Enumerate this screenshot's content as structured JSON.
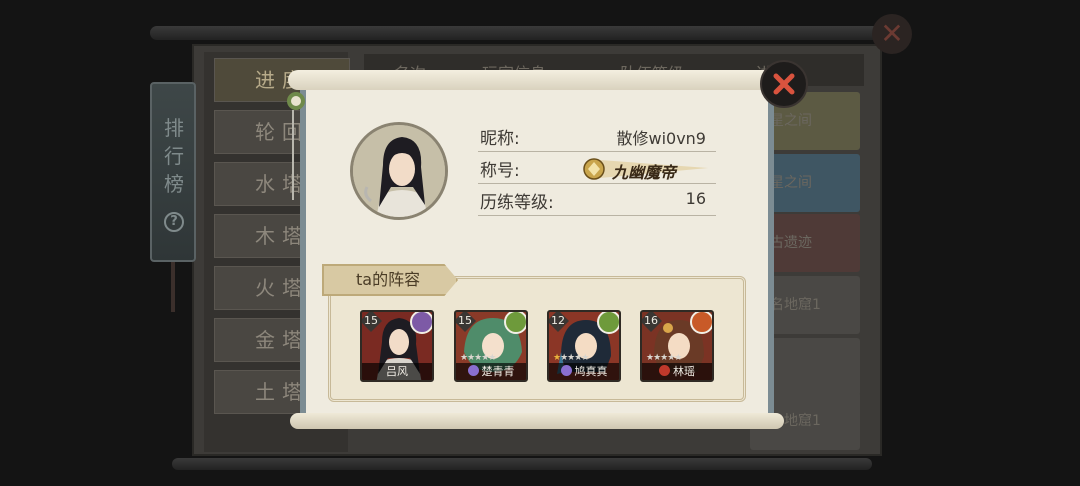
{
  "background": {
    "side_banner": {
      "title": "排行榜",
      "help_icon": "question-icon"
    },
    "tabs": [
      "进度榜",
      "轮回",
      "水塔",
      "木塔榜",
      "火塔榜",
      "金塔榜",
      "土塔榜"
    ],
    "active_tab": 0,
    "table_headers": [
      "名次",
      "玩家信息",
      "队伍等级",
      "进"
    ],
    "rows": [
      "星之间",
      "星之间",
      "古遗迹",
      "名地窟1",
      "",
      "名地窟1"
    ],
    "row_colors": [
      "#5c5a43",
      "#3f5663",
      "#4f3a37",
      "#4a4845",
      "#4a4845",
      "#4a4845"
    ]
  },
  "popup": {
    "close_icon": "close-x-icon",
    "nickname_label": "昵称:",
    "nickname_value": "散修wi0vn9",
    "title_label": "称号:",
    "title_value": "九幽魔帝",
    "level_label": "历练等级:",
    "level_value": "16",
    "lineup_label": "ta的阵容",
    "heroes": [
      {
        "name": "吕风",
        "level": "15",
        "element": "yin-yang",
        "element_color": "#7d5aa6",
        "stars": 0,
        "bg": "#7a2a22"
      },
      {
        "name": "楚青青",
        "level": "15",
        "element": "wood",
        "element_color": "#6e9a3b",
        "stars": 5,
        "bg": "#8a3a28"
      },
      {
        "name": "鸠真真",
        "level": "12",
        "element": "wood",
        "element_color": "#6e9a3b",
        "stars": 5,
        "gold_stars": 1,
        "bg": "#8b3626"
      },
      {
        "name": "林瑶",
        "level": "16",
        "element": "fire",
        "element_color": "#c85a28",
        "stars": 5,
        "bg": "#7b3324"
      }
    ]
  }
}
